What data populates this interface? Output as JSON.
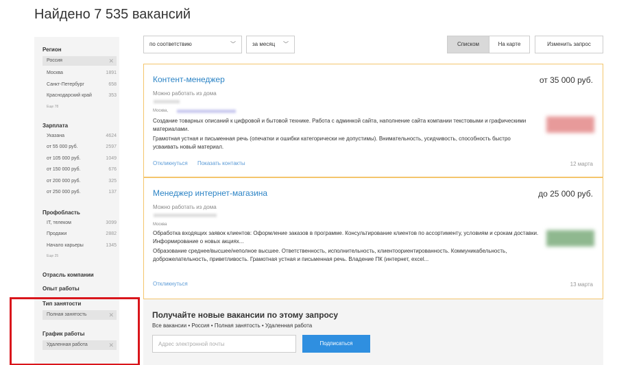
{
  "header": {
    "title": "Найдено 7 535 вакансий"
  },
  "sidebar": {
    "region": {
      "heading": "Регион",
      "selected": "Россия",
      "items": [
        {
          "label": "Москва",
          "count": "1891"
        },
        {
          "label": "Санкт-Петербург",
          "count": "658"
        },
        {
          "label": "Краснодарский край",
          "count": "353"
        }
      ],
      "more": "Еще 78"
    },
    "salary": {
      "heading": "Зарплата",
      "items": [
        {
          "label": "Указана",
          "count": "4624"
        },
        {
          "label": "от 55 000 руб.",
          "count": "2597"
        },
        {
          "label": "от 105 000 руб.",
          "count": "1049"
        },
        {
          "label": "от 150 000 руб.",
          "count": "676"
        },
        {
          "label": "от 200 000 руб.",
          "count": "325"
        },
        {
          "label": "от 250 000 руб.",
          "count": "137"
        }
      ]
    },
    "profarea": {
      "heading": "Профобласть",
      "items": [
        {
          "label": "IT, телеком",
          "count": "3099"
        },
        {
          "label": "Продажи",
          "count": "2882"
        },
        {
          "label": "Начало карьеры",
          "count": "1345"
        }
      ],
      "more": "Еще 25"
    },
    "industry": {
      "heading": "Отрасль компании"
    },
    "experience": {
      "heading": "Опыт работы"
    },
    "employment": {
      "heading": "Тип занятости",
      "selected": "Полная занятость"
    },
    "schedule": {
      "heading": "График работы",
      "selected": "Удаленная работа"
    }
  },
  "toolbar": {
    "sort_value": "по соответствию",
    "period_value": "за месяц",
    "view_list": "Списком",
    "view_map": "На карте",
    "change_query": "Изменить запрос"
  },
  "vacancies": [
    {
      "title": "Контент-менеджер",
      "salary": "от 35 000 руб.",
      "remote": "Можно работать из дома",
      "city": "Москва,",
      "desc": "Создание товарных описаний к цифровой и бытовой технике. Работа с админкой сайта, наполнение сайта компании текстовыми и графическими материалами.",
      "req": "Грамотная устная и письменная речь (опечатки и ошибки категорически не допустимы). Внимательность, усидчивость, способность быстро усваивать новый материал.",
      "respond": "Откликнуться",
      "contacts": "Показать контакты",
      "date": "12 марта",
      "logo_color": "#e06b6b"
    },
    {
      "title": "Менеджер интернет-магазина",
      "salary": "до 25 000 руб.",
      "remote": "Можно работать из дома",
      "city": "Москва",
      "desc": "Обработка входящих заявок клиентов: Оформление заказов в программе. Консультирование клиентов по ассортименту, условиям и срокам доставки. Информирование о новых акциях...",
      "req": "Образование среднее/высшее/неполное высшее. Ответственность, исполнительность, клиентоориентированность. Коммуникабельность, доброжелательность, приветливость. Грамотная устная и письменная речь. Владение ПК (интернет, excel...",
      "respond": "Откликнуться",
      "date": "13 марта",
      "logo_color": "#6a9a6a"
    }
  ],
  "subscribe": {
    "title": "Получайте новые вакансии по этому запросу",
    "desc": "Все вакансии • Россия • Полная занятость • Удаленная работа",
    "placeholder": "Адрес электронной почты",
    "button": "Подписаться"
  },
  "colors": {
    "accent": "#2f8fe0",
    "link": "#2b83c5",
    "card_border": "#f4c56b",
    "highlight": "#d9151b"
  }
}
